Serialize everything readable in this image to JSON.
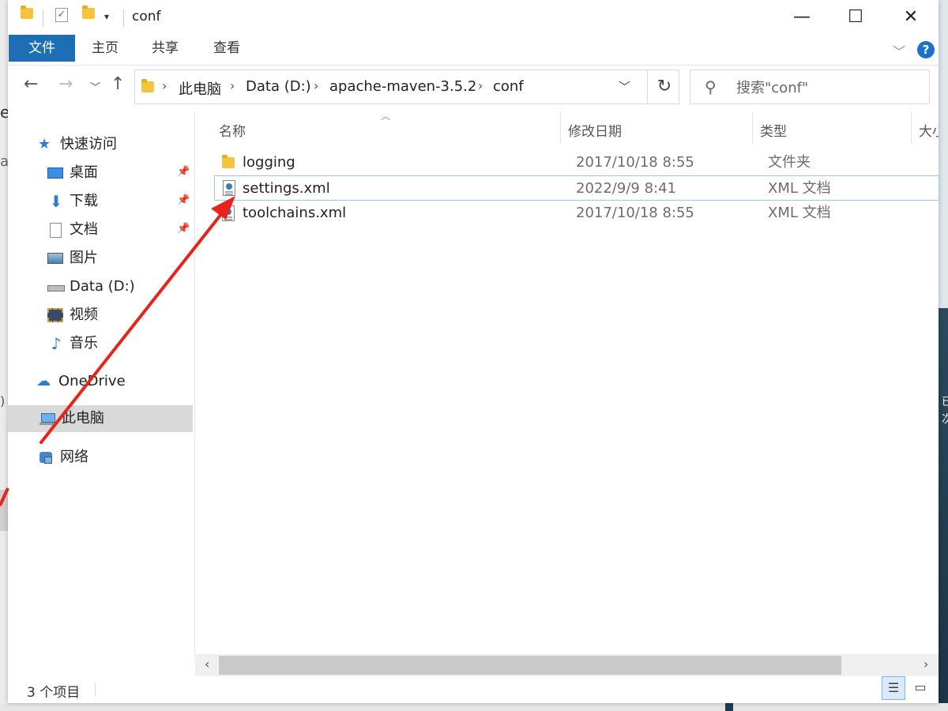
{
  "window": {
    "title": "conf",
    "controls": {
      "minimize": "—",
      "maximize": "☐",
      "close": "✕"
    }
  },
  "ribbon": {
    "tabs": [
      "文件",
      "主页",
      "共享",
      "查看"
    ],
    "help": "?"
  },
  "nav": {
    "breadcrumb": [
      "此电脑",
      "Data (D:)",
      "apache-maven-3.5.2",
      "conf"
    ],
    "search_placeholder": "搜索\"conf\""
  },
  "sidebar": {
    "quick_access": "快速访问",
    "items": [
      {
        "label": "桌面",
        "icon": "desktop-icon",
        "pinned": true
      },
      {
        "label": "下载",
        "icon": "download-icon",
        "pinned": true
      },
      {
        "label": "文档",
        "icon": "document-icon",
        "pinned": true
      },
      {
        "label": "图片",
        "icon": "pictures-icon",
        "pinned": false
      },
      {
        "label": "Data (D:)",
        "icon": "drive-icon",
        "pinned": false
      },
      {
        "label": "视频",
        "icon": "video-icon",
        "pinned": false
      },
      {
        "label": "音乐",
        "icon": "music-icon",
        "pinned": false
      }
    ],
    "onedrive": "OneDrive",
    "this_pc": "此电脑",
    "network": "网络"
  },
  "list": {
    "columns": [
      "名称",
      "修改日期",
      "类型",
      "大小"
    ],
    "rows": [
      {
        "name": "logging",
        "date": "2017/10/18 8:55",
        "type": "文件夹",
        "icon": "folder-icon"
      },
      {
        "name": "settings.xml",
        "date": "2022/9/9 8:41",
        "type": "XML 文档",
        "icon": "xml-file-icon",
        "selected": true
      },
      {
        "name": "toolchains.xml",
        "date": "2017/10/18 8:55",
        "type": "XML 文档",
        "icon": "xml-file-icon"
      }
    ]
  },
  "status": {
    "item_count": "3 个项目"
  },
  "background": {
    "left_chars": [
      "e",
      "a",
      ")"
    ],
    "right_chars": [
      "已",
      "次"
    ]
  },
  "colors": {
    "accent": "#1d6eb5",
    "annotation": "#e8231b",
    "selected_border": "#99c9ef"
  }
}
